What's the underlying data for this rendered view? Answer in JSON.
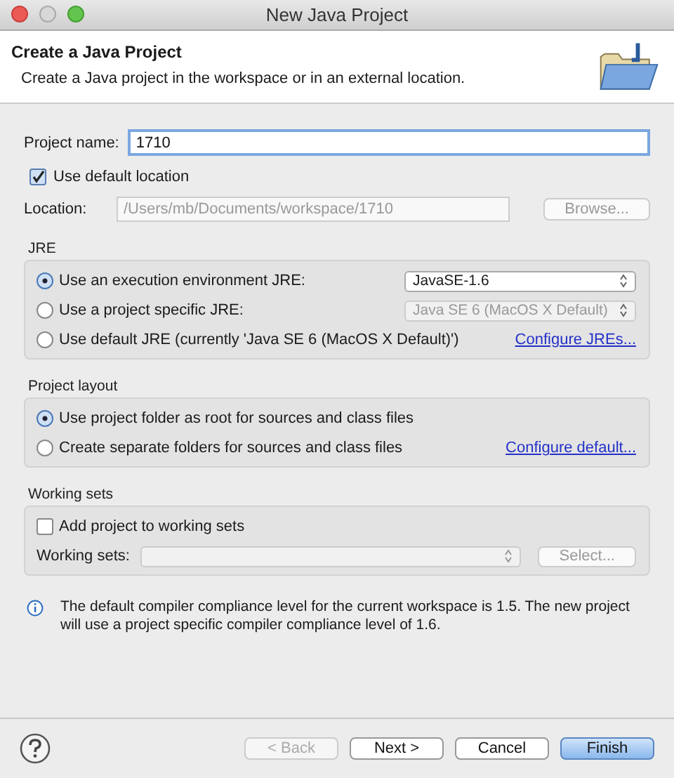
{
  "window": {
    "title": "New Java Project"
  },
  "header": {
    "title": "Create a Java Project",
    "description": "Create a Java project in the workspace or in an external location."
  },
  "project_name": {
    "label": "Project name:",
    "value": "1710"
  },
  "use_default_location": {
    "label": "Use default location",
    "checked": true
  },
  "location": {
    "label": "Location:",
    "value": "/Users/mb/Documents/workspace/1710",
    "disabled": true
  },
  "browse_button": {
    "label": "Browse...",
    "disabled": true
  },
  "jre": {
    "title": "JRE",
    "options": [
      {
        "label": "Use an execution environment JRE:",
        "selected": true,
        "kind": "dropdown",
        "value": "JavaSE-1.6",
        "disabled": false
      },
      {
        "label": "Use a project specific JRE:",
        "selected": false,
        "kind": "dropdown",
        "value": "Java SE 6 (MacOS X Default)",
        "disabled": true
      },
      {
        "label": "Use default JRE (currently 'Java SE 6 (MacOS X Default)')",
        "selected": false,
        "kind": "link",
        "link": "Configure JREs..."
      }
    ]
  },
  "project_layout": {
    "title": "Project layout",
    "options": [
      {
        "label": "Use project folder as root for sources and class files",
        "selected": true,
        "kind": "plain"
      },
      {
        "label": "Create separate folders for sources and class files",
        "selected": false,
        "kind": "link",
        "link": "Configure default..."
      }
    ]
  },
  "working_sets": {
    "title": "Working sets",
    "add": {
      "label": "Add project to working sets",
      "checked": false
    },
    "field_label": "Working sets:",
    "field_disabled": true,
    "select_button": {
      "label": "Select...",
      "disabled": true
    }
  },
  "info": "The default compiler compliance level for the current workspace is 1.5. The new project will use a project specific compiler compliance level of 1.6.",
  "buttons": [
    {
      "label": "< Back",
      "disabled": true,
      "default": false
    },
    {
      "label": "Next >",
      "disabled": false,
      "default": false
    },
    {
      "label": "Cancel",
      "disabled": false,
      "default": false
    },
    {
      "label": "Finish",
      "disabled": false,
      "default": true
    }
  ]
}
